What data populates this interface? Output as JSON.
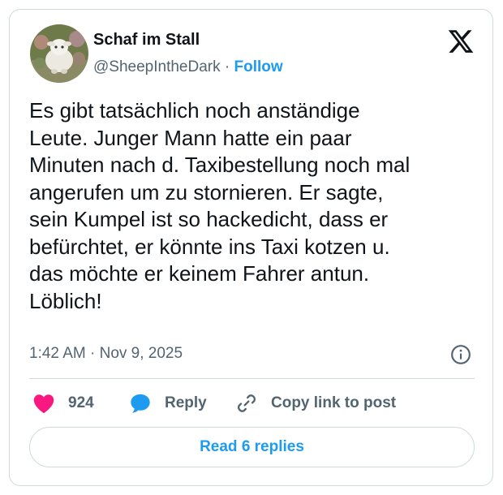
{
  "author": {
    "name": "Schaf im Stall",
    "handle": "@SheepIntheDark",
    "separator": "·",
    "follow_label": "Follow"
  },
  "tweet": {
    "lines": [
      "Es gibt tatsächlich noch anständige",
      "Leute. Junger Mann hatte ein paar",
      "Minuten nach d. Taxibestellung noch mal",
      "angerufen um zu stornieren. Er sagte,",
      "sein Kumpel ist so hackedicht, dass er",
      "befürchtet, er könnte ins Taxi kotzen u.",
      "das möchte er keinem Fahrer antun.",
      "Löblich!"
    ],
    "timestamp": "1:42 AM · Nov 9, 2025"
  },
  "actions": {
    "like_count": "924",
    "reply_label": "Reply",
    "copy_label": "Copy link to post"
  },
  "read_replies_label": "Read 6 replies",
  "icons": {
    "logo": "x-logo-icon",
    "info": "info-icon",
    "like": "heart-icon",
    "reply": "speech-bubble-icon",
    "copy": "link-icon"
  },
  "colors": {
    "accent": "#1d9bf0",
    "heart": "#f91880",
    "muted": "#536471",
    "text": "#0f1419",
    "border": "#cfd9de"
  }
}
